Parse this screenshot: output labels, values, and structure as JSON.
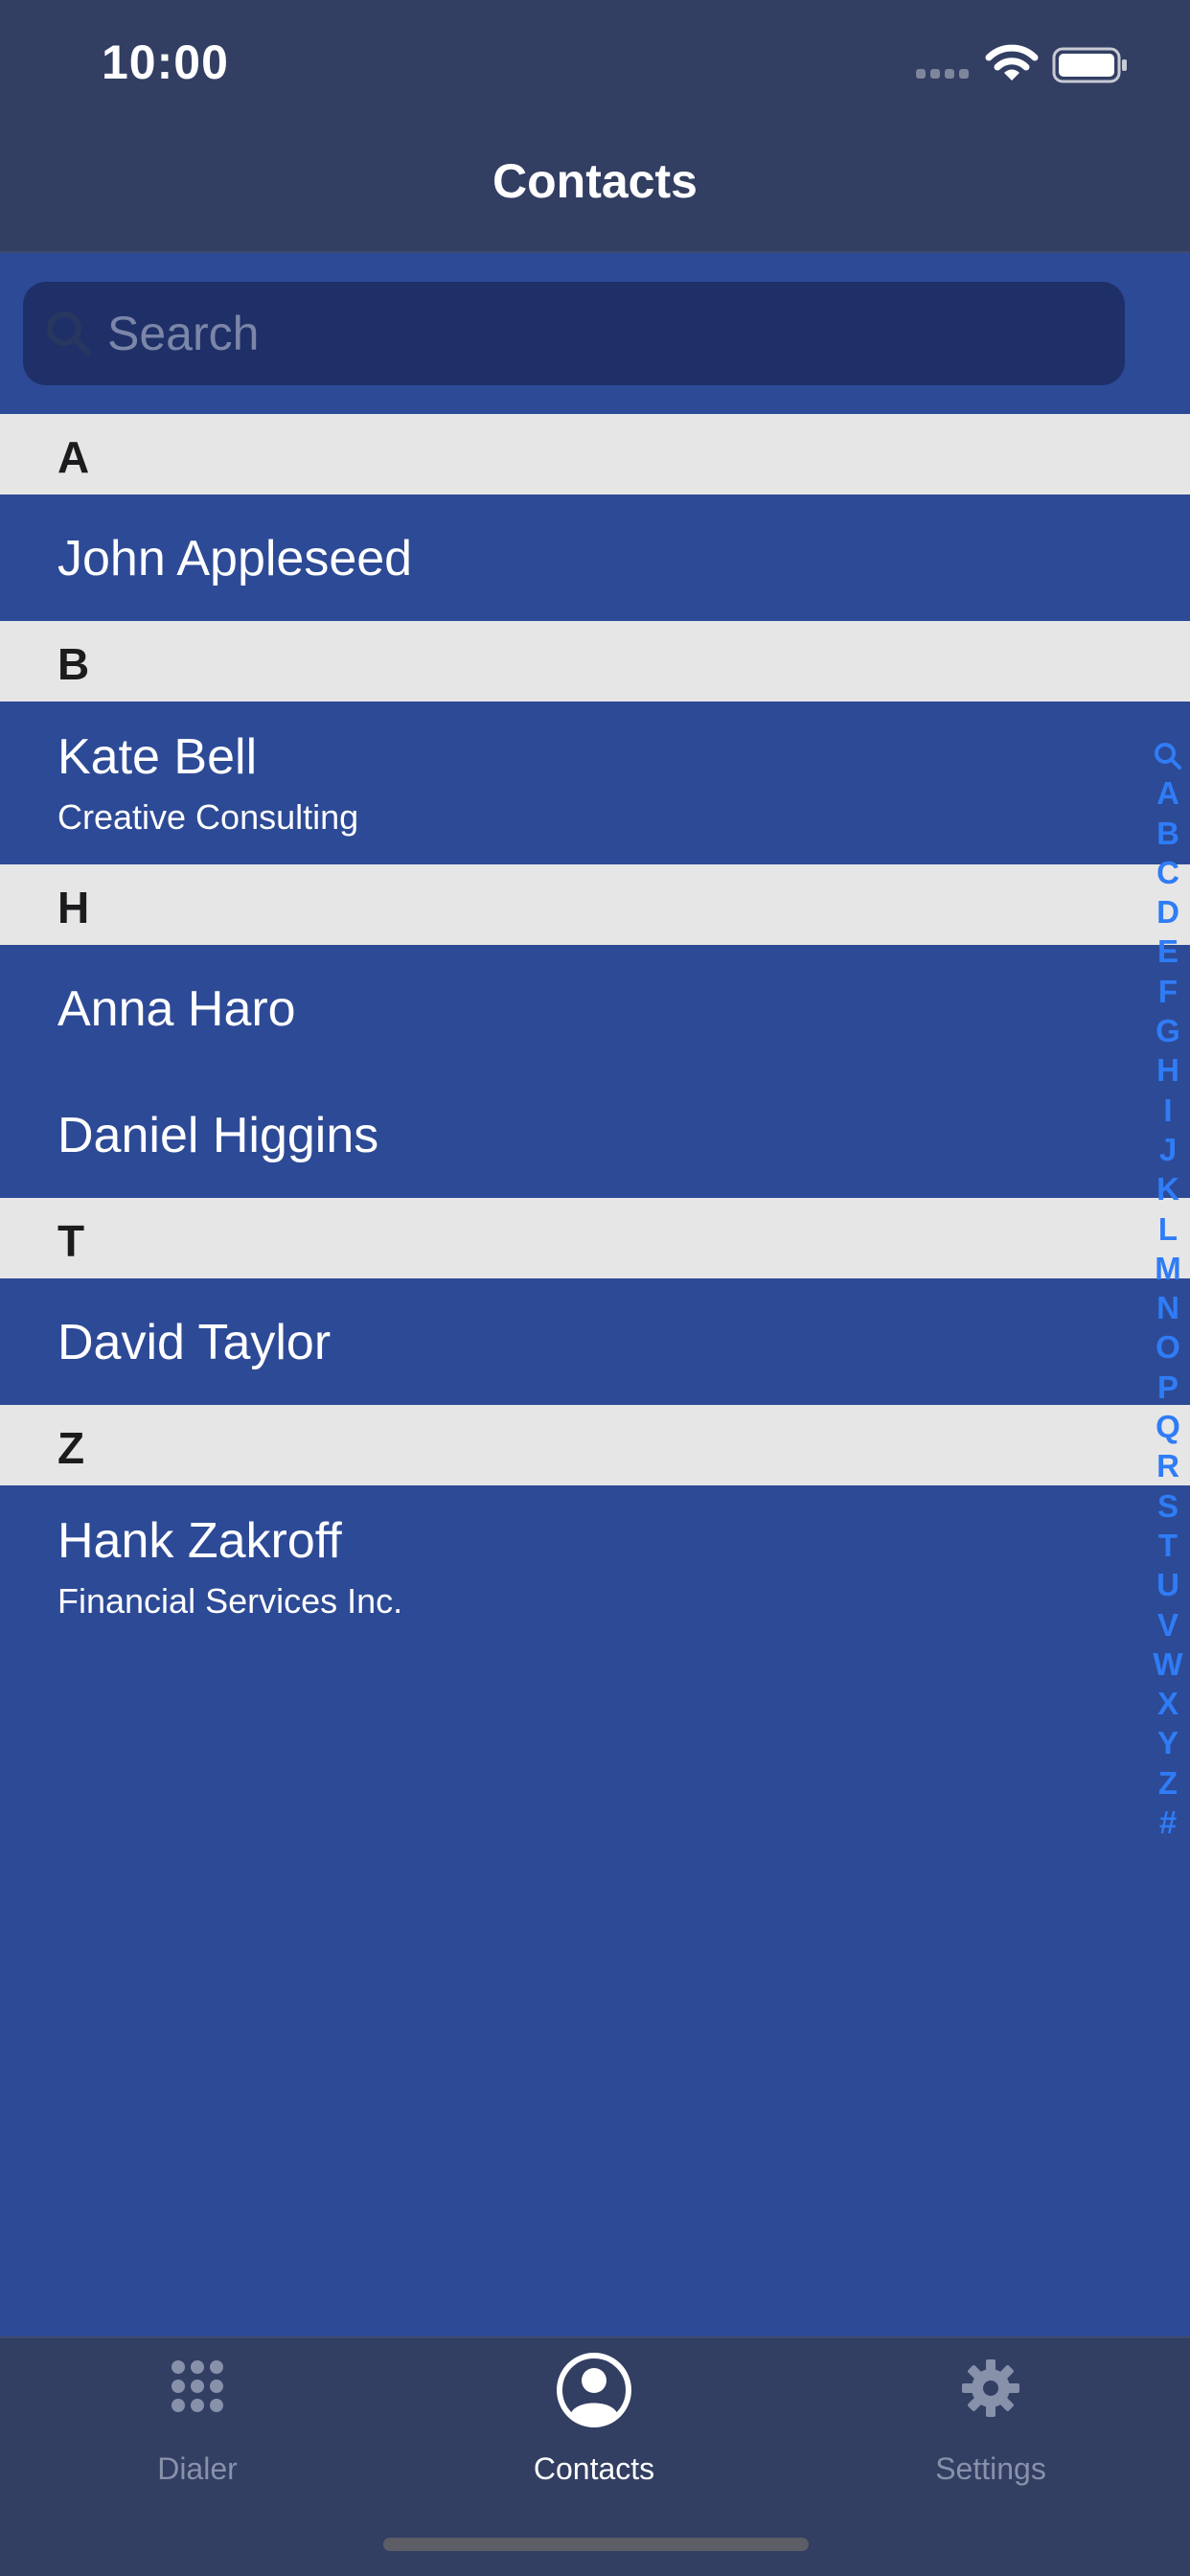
{
  "status_bar": {
    "time": "10:00"
  },
  "nav": {
    "title": "Contacts"
  },
  "search": {
    "placeholder": "Search"
  },
  "sections": [
    {
      "letter": "A",
      "contacts": [
        {
          "name": "John Appleseed",
          "company": ""
        }
      ]
    },
    {
      "letter": "B",
      "contacts": [
        {
          "name": "Kate Bell",
          "company": "Creative Consulting"
        }
      ]
    },
    {
      "letter": "H",
      "contacts": [
        {
          "name": "Anna Haro",
          "company": ""
        },
        {
          "name": "Daniel Higgins",
          "company": ""
        }
      ]
    },
    {
      "letter": "T",
      "contacts": [
        {
          "name": "David Taylor",
          "company": ""
        }
      ]
    },
    {
      "letter": "Z",
      "contacts": [
        {
          "name": "Hank Zakroff",
          "company": "Financial Services Inc."
        }
      ]
    }
  ],
  "index": [
    "A",
    "B",
    "C",
    "D",
    "E",
    "F",
    "G",
    "H",
    "I",
    "J",
    "K",
    "L",
    "M",
    "N",
    "O",
    "P",
    "Q",
    "R",
    "S",
    "T",
    "U",
    "V",
    "W",
    "X",
    "Y",
    "Z",
    "#"
  ],
  "tabs": [
    {
      "label": "Dialer",
      "icon": "dialpad-icon",
      "active": false
    },
    {
      "label": "Contacts",
      "icon": "person-circle-icon",
      "active": true
    },
    {
      "label": "Settings",
      "icon": "gear-icon",
      "active": false
    }
  ],
  "colors": {
    "bar_background": "#323e62",
    "list_background": "#2d4a96",
    "section_header": "#e6e6e6",
    "index_accent": "#2f7cf6",
    "tab_inactive": "#8891aa"
  }
}
